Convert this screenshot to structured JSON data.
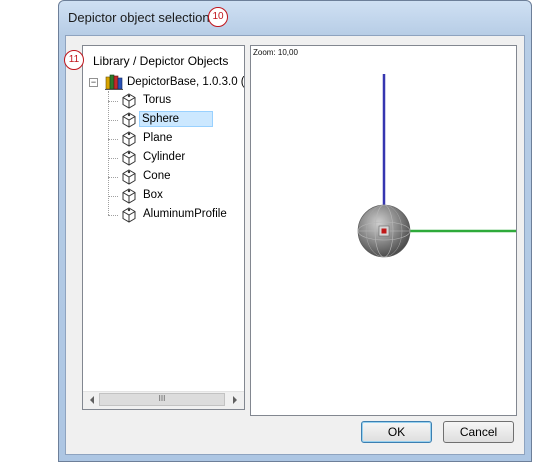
{
  "window": {
    "title": "Depictor object selection",
    "title_badge": "10"
  },
  "tree": {
    "badge": "11",
    "header": "Library / Depictor Objects",
    "root": {
      "label": "DepictorBase, 1.0.3.0 (",
      "expander": "−"
    },
    "items": [
      {
        "label": "Torus",
        "selected": false
      },
      {
        "label": "Sphere",
        "selected": true
      },
      {
        "label": "Plane",
        "selected": false
      },
      {
        "label": "Cylinder",
        "selected": false
      },
      {
        "label": "Cone",
        "selected": false
      },
      {
        "label": "Box",
        "selected": false
      },
      {
        "label": "AluminumProfile",
        "selected": false
      }
    ],
    "scroll_thumb_grip": "III"
  },
  "viewport": {
    "zoom_label": "Zoom: 10,00",
    "axis_colors": {
      "y_axis": "#3636b0",
      "x_axis": "#2eaa3a"
    },
    "sphere_color": "#8a8a8a",
    "center_marker_color": "#c01818"
  },
  "buttons": {
    "ok_label": "OK",
    "cancel_label": "Cancel"
  },
  "colors": {
    "badge": "#c0141b",
    "selection_bg": "#cce8ff",
    "window_frame": "#b7cde6"
  }
}
